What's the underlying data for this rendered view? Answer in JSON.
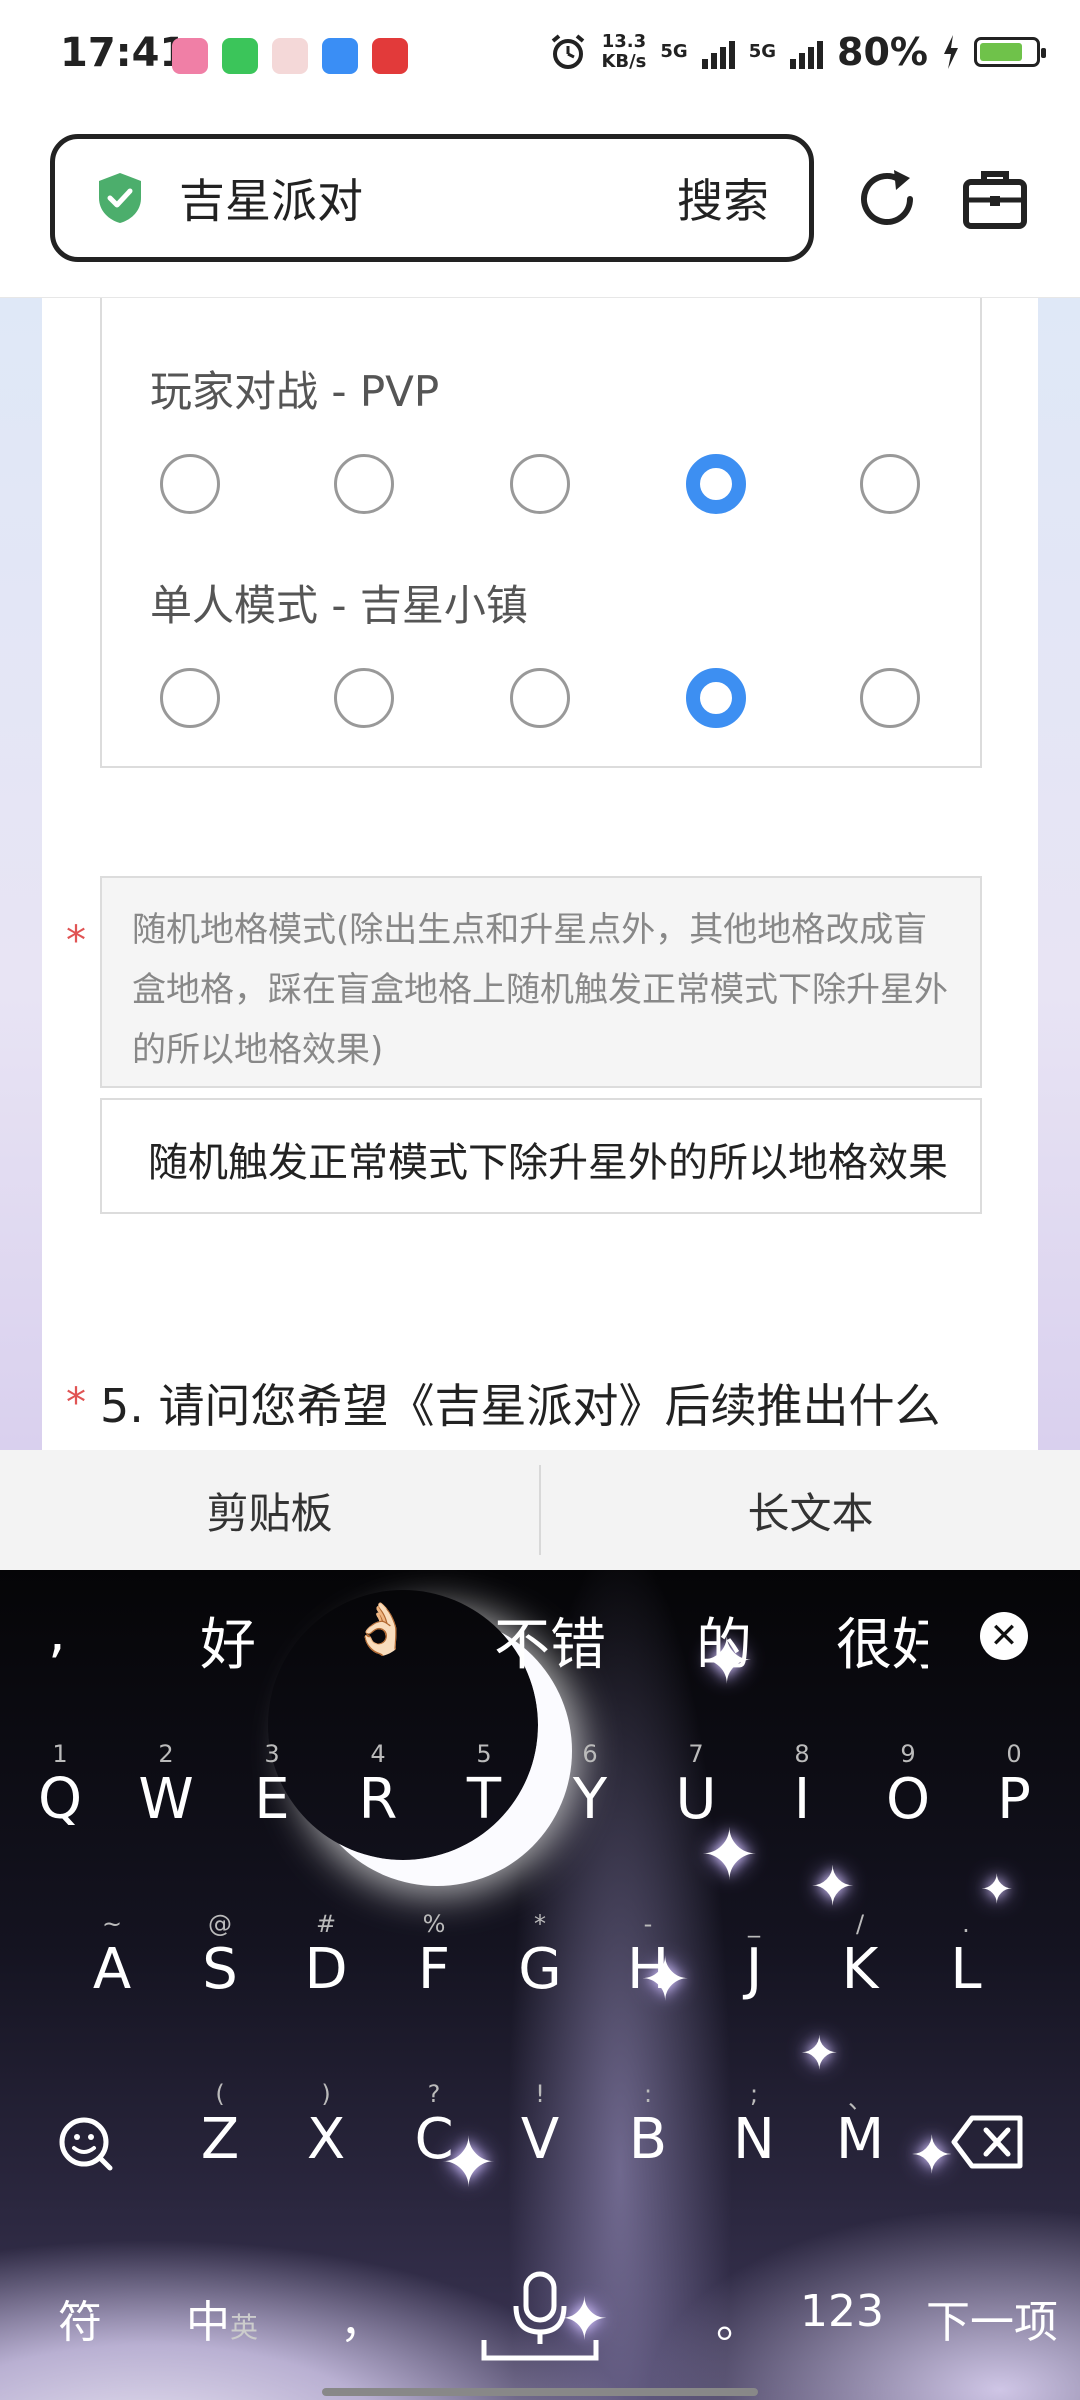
{
  "status_bar": {
    "time": "17:41",
    "speed_value": "13.3",
    "speed_unit": "KB/s",
    "net1": "5G",
    "net2": "5G",
    "battery_pct": "80%"
  },
  "browser": {
    "search_text": "吉星派对",
    "search_button": "搜索"
  },
  "form": {
    "matrix_rows": [
      {
        "label": "玩家对战 - PVP",
        "selected_index": 3,
        "options": 5
      },
      {
        "label": "单人模式 - 吉星小镇",
        "selected_index": 3,
        "options": 5
      }
    ],
    "required_mark": "*",
    "description": "随机地格模式(除出生点和升星点外，其他地格改成盲盒地格，踩在盲盒地格上随机触发正常模式下除升星外的所以地格效果)",
    "answer_value": "随机触发正常模式下除升星外的所以地格效果",
    "next_question": "5. 请问您希望《吉星派对》后续推出什么"
  },
  "keyboard_toolbar": {
    "clipboard": "剪贴板",
    "long_text": "长文本"
  },
  "keyboard": {
    "candidates": [
      ",",
      "好",
      "👌🏻",
      "不错",
      "的",
      "很好"
    ],
    "row1": [
      {
        "k": "Q",
        "h": "1"
      },
      {
        "k": "W",
        "h": "2"
      },
      {
        "k": "E",
        "h": "3"
      },
      {
        "k": "R",
        "h": "4"
      },
      {
        "k": "T",
        "h": "5"
      },
      {
        "k": "Y",
        "h": "6"
      },
      {
        "k": "U",
        "h": "7"
      },
      {
        "k": "I",
        "h": "8"
      },
      {
        "k": "O",
        "h": "9"
      },
      {
        "k": "P",
        "h": "0"
      }
    ],
    "row2": [
      {
        "k": "A",
        "h": "~"
      },
      {
        "k": "S",
        "h": "@"
      },
      {
        "k": "D",
        "h": "#"
      },
      {
        "k": "F",
        "h": "%"
      },
      {
        "k": "G",
        "h": "*"
      },
      {
        "k": "H",
        "h": "-"
      },
      {
        "k": "J",
        "h": "_"
      },
      {
        "k": "K",
        "h": "/"
      },
      {
        "k": "L",
        "h": "."
      }
    ],
    "row3": [
      {
        "k": "Z",
        "h": "("
      },
      {
        "k": "X",
        "h": ")"
      },
      {
        "k": "C",
        "h": "?"
      },
      {
        "k": "V",
        "h": "!"
      },
      {
        "k": "B",
        "h": ":"
      },
      {
        "k": "N",
        "h": ";"
      },
      {
        "k": "M",
        "h": "、"
      }
    ],
    "symbol_key": "符",
    "lang_key_main": "中",
    "lang_key_sub": "英",
    "comma_key": "，",
    "period_key": "。",
    "num_key": "123",
    "next_key": "下一项"
  },
  "colors": {
    "accent": "#3d8ff2",
    "required": "#e05454",
    "shield": "#4cae6c"
  }
}
